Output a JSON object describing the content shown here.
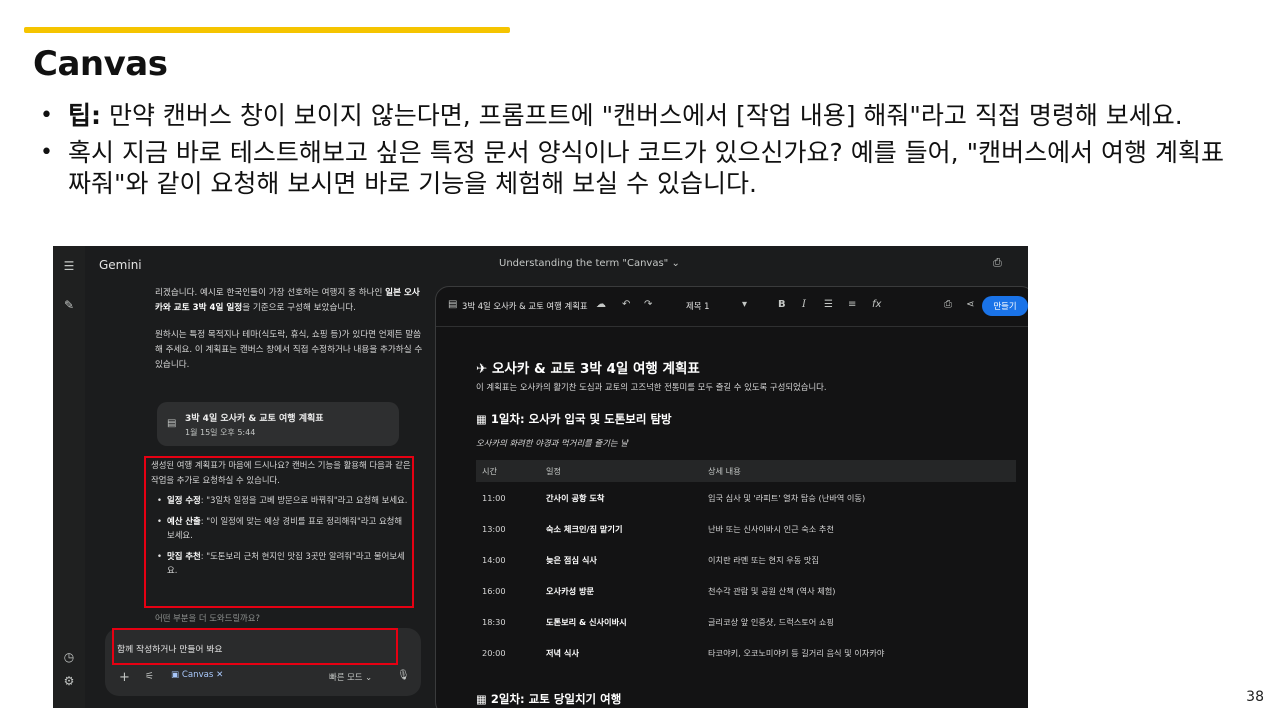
{
  "slide": {
    "title": "Canvas",
    "page_number": "38",
    "bullet1_bold": "팁:",
    "bullet1_rest": " 만약 캔버스 창이 보이지 않는다면, 프롬프트에 \"캔버스에서 [작업 내용] 해줘\"라고 직접 명령해 보세요.",
    "bullet2": "혹시 지금 바로 테스트해보고 싶은 특정 문서 양식이나 코드가 있으신가요? 예를 들어, \"캔버스에서 여행 계획표 짜줘\"와 같이 요청해 보시면 바로 기능을 체험해 보실 수 있습니다.",
    "accent_color": "#f5c400",
    "highlight_color": "#e60012"
  },
  "app": {
    "name": "Gemini",
    "conversation_title": "Understanding the term \"Canvas\"",
    "icons": [
      "menu-icon",
      "new-chat-icon",
      "history-icon",
      "settings-icon",
      "print-icon"
    ]
  },
  "chat": {
    "para1_a": "리겠습니다. 예시로 한국인들이 가장 선호하는 여행지 중 하나인 ",
    "para1_bold": "일본 오사카와 교토 3박 4일 일정",
    "para1_b": "을 기준으로 구성해 보았습니다.",
    "para2": "원하시는 특정 목적지나 테마(식도락, 휴식, 쇼핑 등)가 있다면 언제든 말씀해 주세요. 이 계획표는 캔버스 창에서 직접 수정하거나 내용을 추가하실 수 있습니다.",
    "card_title": "3박 4일 오사카 & 교토 여행 계획표",
    "card_time": "1월 15일 오후 5:44",
    "followup": "생성된 여행 계획표가 마음에 드시나요? 캔버스 기능을 활용해 다음과 같은 작업을 추가로 요청하실 수 있습니다.",
    "suggestions": [
      {
        "label": "일정 수정",
        "text": ": \"3일차 일정을 고베 방문으로 바꿔줘\"라고 요청해 보세요."
      },
      {
        "label": "예산 산출",
        "text": ": \"이 일정에 맞는 예상 경비를 표로 정리해줘\"라고 요청해 보세요."
      },
      {
        "label": "맛집 추천",
        "text": ": \"도톤보리 근처 현지인 맛집 3곳만 알려줘\"라고 물어보세요."
      }
    ],
    "more_question": "어떤 부분을 더 도와드릴까요?"
  },
  "input": {
    "placeholder": "함께 작성하거나 만들어 봐요",
    "canvas_chip": "Canvas",
    "mode": "빠른 모드"
  },
  "canvas": {
    "doc_name": "3박 4일 오사카 & 교토 여행 계획표",
    "style": "제목 1",
    "create_button": "만들기",
    "heading": "오사카 & 교토 3박 4일 여행 계획표",
    "intro": "이 계획표는 오사카의 활기찬 도심과 교토의 고즈넉한 전통미를 모두 즐길 수 있도록 구성되었습니다.",
    "day1_title": "1일차: 오사카 입국 및 도톤보리 탐방",
    "day1_sub": "오사카의 화려한 야경과 먹거리를 즐기는 날",
    "table_headers": [
      "시간",
      "일정",
      "상세 내용"
    ],
    "rows": [
      [
        "11:00",
        "간사이 공항 도착",
        "입국 심사 및 '라피트' 열차 탑승 (난바역 이동)"
      ],
      [
        "13:00",
        "숙소 체크인/짐 맡기기",
        "난바 또는 신사이바시 인근 숙소 추천"
      ],
      [
        "14:00",
        "늦은 점심 식사",
        "이치란 라멘 또는 현지 우동 맛집"
      ],
      [
        "16:00",
        "오사카성 방문",
        "천수각 관람 및 공원 산책 (역사 체험)"
      ],
      [
        "18:30",
        "도톤보리 & 신사이바시",
        "글리코상 앞 인증샷, 드럭스토어 쇼핑"
      ],
      [
        "20:00",
        "저녁 식사",
        "타코야키, 오코노미야키 등 길거리 음식 및 이자카야"
      ]
    ],
    "day2_title": "2일차: 교토 당일치기 여행"
  }
}
